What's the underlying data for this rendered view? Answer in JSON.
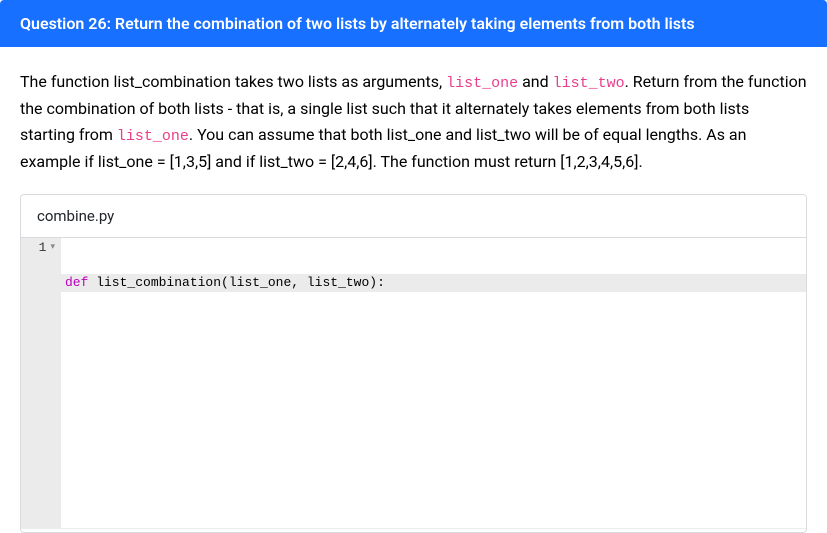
{
  "header": {
    "title": "Question 26: Return the combination of two lists by alternately taking elements from both lists"
  },
  "description": {
    "part1": "The function list_combination takes two lists as arguments, ",
    "code1": "list_one",
    "part2": " and ",
    "code2": "list_two",
    "part3": ". Return from the function the combination of both lists - that is, a single list such that it alternately takes elements from both lists starting from ",
    "code3": "list_one",
    "part4": ". You can assume that both list_one and list_two will be of equal lengths. As an example if list_one = [1,3,5] and if list_two = [2,4,6]. The function must return [1,2,3,4,5,6]."
  },
  "editor": {
    "filename": "combine.py",
    "gutter": {
      "line1": "1"
    },
    "code": {
      "line1": {
        "kw": "def",
        "fn": " list_combination",
        "open": "(",
        "p1": "list_one",
        "comma": ", ",
        "p2": "list_two",
        "close": "):"
      }
    }
  }
}
